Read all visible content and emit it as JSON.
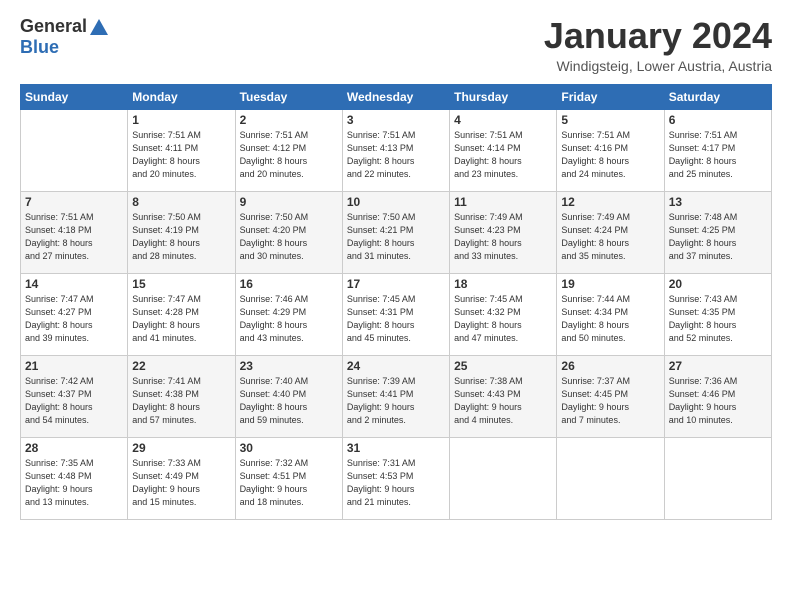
{
  "logo": {
    "general": "General",
    "blue": "Blue"
  },
  "title": "January 2024",
  "subtitle": "Windigsteig, Lower Austria, Austria",
  "days_of_week": [
    "Sunday",
    "Monday",
    "Tuesday",
    "Wednesday",
    "Thursday",
    "Friday",
    "Saturday"
  ],
  "weeks": [
    [
      {
        "num": "",
        "info": ""
      },
      {
        "num": "1",
        "info": "Sunrise: 7:51 AM\nSunset: 4:11 PM\nDaylight: 8 hours\nand 20 minutes."
      },
      {
        "num": "2",
        "info": "Sunrise: 7:51 AM\nSunset: 4:12 PM\nDaylight: 8 hours\nand 20 minutes."
      },
      {
        "num": "3",
        "info": "Sunrise: 7:51 AM\nSunset: 4:13 PM\nDaylight: 8 hours\nand 22 minutes."
      },
      {
        "num": "4",
        "info": "Sunrise: 7:51 AM\nSunset: 4:14 PM\nDaylight: 8 hours\nand 23 minutes."
      },
      {
        "num": "5",
        "info": "Sunrise: 7:51 AM\nSunset: 4:16 PM\nDaylight: 8 hours\nand 24 minutes."
      },
      {
        "num": "6",
        "info": "Sunrise: 7:51 AM\nSunset: 4:17 PM\nDaylight: 8 hours\nand 25 minutes."
      }
    ],
    [
      {
        "num": "7",
        "info": "Sunrise: 7:51 AM\nSunset: 4:18 PM\nDaylight: 8 hours\nand 27 minutes."
      },
      {
        "num": "8",
        "info": "Sunrise: 7:50 AM\nSunset: 4:19 PM\nDaylight: 8 hours\nand 28 minutes."
      },
      {
        "num": "9",
        "info": "Sunrise: 7:50 AM\nSunset: 4:20 PM\nDaylight: 8 hours\nand 30 minutes."
      },
      {
        "num": "10",
        "info": "Sunrise: 7:50 AM\nSunset: 4:21 PM\nDaylight: 8 hours\nand 31 minutes."
      },
      {
        "num": "11",
        "info": "Sunrise: 7:49 AM\nSunset: 4:23 PM\nDaylight: 8 hours\nand 33 minutes."
      },
      {
        "num": "12",
        "info": "Sunrise: 7:49 AM\nSunset: 4:24 PM\nDaylight: 8 hours\nand 35 minutes."
      },
      {
        "num": "13",
        "info": "Sunrise: 7:48 AM\nSunset: 4:25 PM\nDaylight: 8 hours\nand 37 minutes."
      }
    ],
    [
      {
        "num": "14",
        "info": "Sunrise: 7:47 AM\nSunset: 4:27 PM\nDaylight: 8 hours\nand 39 minutes."
      },
      {
        "num": "15",
        "info": "Sunrise: 7:47 AM\nSunset: 4:28 PM\nDaylight: 8 hours\nand 41 minutes."
      },
      {
        "num": "16",
        "info": "Sunrise: 7:46 AM\nSunset: 4:29 PM\nDaylight: 8 hours\nand 43 minutes."
      },
      {
        "num": "17",
        "info": "Sunrise: 7:45 AM\nSunset: 4:31 PM\nDaylight: 8 hours\nand 45 minutes."
      },
      {
        "num": "18",
        "info": "Sunrise: 7:45 AM\nSunset: 4:32 PM\nDaylight: 8 hours\nand 47 minutes."
      },
      {
        "num": "19",
        "info": "Sunrise: 7:44 AM\nSunset: 4:34 PM\nDaylight: 8 hours\nand 50 minutes."
      },
      {
        "num": "20",
        "info": "Sunrise: 7:43 AM\nSunset: 4:35 PM\nDaylight: 8 hours\nand 52 minutes."
      }
    ],
    [
      {
        "num": "21",
        "info": "Sunrise: 7:42 AM\nSunset: 4:37 PM\nDaylight: 8 hours\nand 54 minutes."
      },
      {
        "num": "22",
        "info": "Sunrise: 7:41 AM\nSunset: 4:38 PM\nDaylight: 8 hours\nand 57 minutes."
      },
      {
        "num": "23",
        "info": "Sunrise: 7:40 AM\nSunset: 4:40 PM\nDaylight: 8 hours\nand 59 minutes."
      },
      {
        "num": "24",
        "info": "Sunrise: 7:39 AM\nSunset: 4:41 PM\nDaylight: 9 hours\nand 2 minutes."
      },
      {
        "num": "25",
        "info": "Sunrise: 7:38 AM\nSunset: 4:43 PM\nDaylight: 9 hours\nand 4 minutes."
      },
      {
        "num": "26",
        "info": "Sunrise: 7:37 AM\nSunset: 4:45 PM\nDaylight: 9 hours\nand 7 minutes."
      },
      {
        "num": "27",
        "info": "Sunrise: 7:36 AM\nSunset: 4:46 PM\nDaylight: 9 hours\nand 10 minutes."
      }
    ],
    [
      {
        "num": "28",
        "info": "Sunrise: 7:35 AM\nSunset: 4:48 PM\nDaylight: 9 hours\nand 13 minutes."
      },
      {
        "num": "29",
        "info": "Sunrise: 7:33 AM\nSunset: 4:49 PM\nDaylight: 9 hours\nand 15 minutes."
      },
      {
        "num": "30",
        "info": "Sunrise: 7:32 AM\nSunset: 4:51 PM\nDaylight: 9 hours\nand 18 minutes."
      },
      {
        "num": "31",
        "info": "Sunrise: 7:31 AM\nSunset: 4:53 PM\nDaylight: 9 hours\nand 21 minutes."
      },
      {
        "num": "",
        "info": ""
      },
      {
        "num": "",
        "info": ""
      },
      {
        "num": "",
        "info": ""
      }
    ]
  ]
}
